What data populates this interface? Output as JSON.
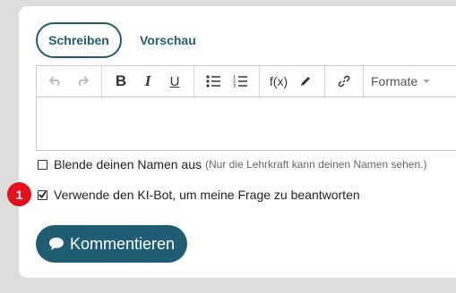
{
  "tabs": {
    "write": "Schreiben",
    "preview": "Vorschau"
  },
  "toolbar": {
    "undo_icon": "undo-icon",
    "redo_icon": "redo-icon",
    "bold": "B",
    "italic": "I",
    "underline": "U",
    "formula": "f(x)",
    "formats": "Formate"
  },
  "options": {
    "hide_name": {
      "label": "Blende deinen Namen aus",
      "hint": "(Nur die Lehrkraft kann deinen Namen sehen.)",
      "checked": false
    },
    "use_bot": {
      "label": "Verwende den KI-Bot, um meine Frage zu beantworten",
      "checked": true
    }
  },
  "badge": {
    "number": "1",
    "color": "#e3101d"
  },
  "submit": {
    "label": "Kommentieren"
  },
  "colors": {
    "accent": "#1f5d72",
    "background": "#dcdcdc"
  }
}
